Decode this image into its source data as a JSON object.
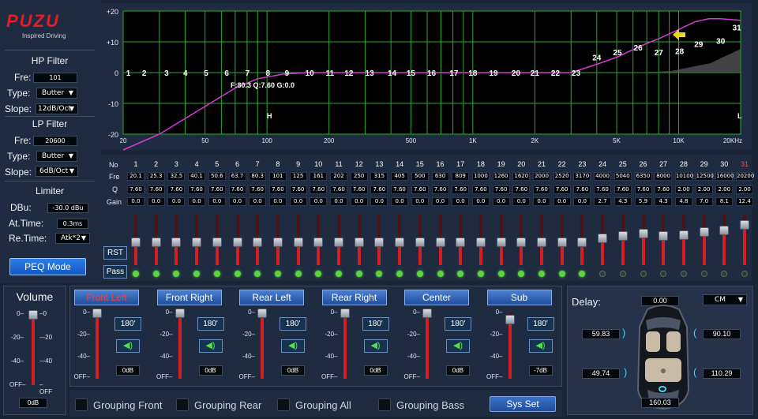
{
  "brand": {
    "name": "PUZU",
    "tagline": "Inspired Driving"
  },
  "hp": {
    "title": "HP Filter",
    "fre_label": "Fre:",
    "fre": "101",
    "type_label": "Type:",
    "type": "Butter",
    "slope_label": "Slope:",
    "slope": "12dB/Oct"
  },
  "lp": {
    "title": "LP Filter",
    "fre_label": "Fre:",
    "fre": "20600",
    "type_label": "Type:",
    "type": "Butter",
    "slope_label": "Slope:",
    "slope": "6dB/Oct"
  },
  "limiter": {
    "title": "Limiter",
    "dbu_label": "DBu:",
    "dbu": "-30.0 dBu",
    "at_label": "At.Time:",
    "at": "0.3ms",
    "re_label": "Re.Time:",
    "re": "Atk*2"
  },
  "peq_button": "PEQ Mode",
  "graph": {
    "ylabels": [
      "+20",
      "+10",
      "0",
      "-10",
      "-20"
    ],
    "xlabels": [
      "20",
      "50",
      "100",
      "200",
      "500",
      "1K",
      "2K",
      "5K",
      "10K",
      "20KHz"
    ],
    "marker_h": "H",
    "marker_l": "L",
    "info": "F:80.3 Q:7.60 G:0.0",
    "band_labels": [
      "1",
      "2",
      "3",
      "4",
      "5",
      "6",
      "7",
      "8",
      "9",
      "10",
      "11",
      "12",
      "13",
      "14",
      "15",
      "16",
      "17",
      "18",
      "19",
      "20",
      "21",
      "22",
      "23",
      "24",
      "25",
      "26",
      "27",
      "28",
      "29",
      "30",
      "31"
    ]
  },
  "eq": {
    "row_no": "No",
    "row_fre": "Fre",
    "row_q": "Q",
    "row_gain": "Gain",
    "bands": [
      "1",
      "2",
      "3",
      "4",
      "5",
      "6",
      "7",
      "8",
      "9",
      "10",
      "11",
      "12",
      "13",
      "14",
      "15",
      "16",
      "17",
      "18",
      "19",
      "20",
      "21",
      "22",
      "23",
      "24",
      "25",
      "26",
      "27",
      "28",
      "29",
      "30",
      "31"
    ],
    "fre": [
      "20.1",
      "25.3",
      "32.5",
      "40.1",
      "50.6",
      "63.7",
      "80.3",
      "101",
      "125",
      "161",
      "202",
      "250",
      "315",
      "405",
      "500",
      "630",
      "809",
      "1000",
      "1260",
      "1620",
      "2000",
      "2520",
      "3170",
      "4000",
      "5040",
      "6350",
      "8000",
      "10100",
      "12500",
      "16000",
      "20200"
    ],
    "q": [
      "7.60",
      "7.60",
      "7.60",
      "7.60",
      "7.60",
      "7.60",
      "7.60",
      "7.60",
      "7.60",
      "7.60",
      "7.60",
      "7.60",
      "7.60",
      "7.60",
      "7.60",
      "7.60",
      "7.60",
      "7.60",
      "7.60",
      "7.60",
      "7.60",
      "7.60",
      "7.60",
      "7.60",
      "7.60",
      "7.60",
      "7.60",
      "2.00",
      "2.00",
      "2.00",
      "2.00"
    ],
    "gain": [
      "0.0",
      "0.0",
      "0.0",
      "0.0",
      "0.0",
      "0.0",
      "0.0",
      "0.0",
      "0.0",
      "0.0",
      "0.0",
      "0.0",
      "0.0",
      "0.0",
      "0.0",
      "0.0",
      "0.0",
      "0.0",
      "0.0",
      "0.0",
      "0.0",
      "0.0",
      "0.0",
      "2.7",
      "4.3",
      "5.9",
      "4.3",
      "4.8",
      "7.0",
      "8.1",
      "12.4"
    ],
    "pass_on": [
      true,
      true,
      true,
      true,
      true,
      true,
      true,
      true,
      true,
      true,
      true,
      true,
      true,
      true,
      true,
      true,
      true,
      true,
      true,
      true,
      true,
      true,
      true,
      false,
      false,
      false,
      false,
      false,
      false,
      false,
      false
    ],
    "rst": "RST",
    "pass": "Pass"
  },
  "volume": {
    "title": "Volume",
    "ticks": [
      "0",
      "-20",
      "-40",
      "OFF"
    ],
    "value": "0dB"
  },
  "channels": [
    {
      "name": "Front Left",
      "phase": "180'",
      "db": "0dB",
      "level": 1.0,
      "active": true
    },
    {
      "name": "Front Right",
      "phase": "180'",
      "db": "0dB",
      "level": 1.0,
      "active": false
    },
    {
      "name": "Rear Left",
      "phase": "180'",
      "db": "0dB",
      "level": 1.0,
      "active": false
    },
    {
      "name": "Rear Right",
      "phase": "180'",
      "db": "0dB",
      "level": 1.0,
      "active": false
    },
    {
      "name": "Center",
      "phase": "180'",
      "db": "0dB",
      "level": 1.0,
      "active": false
    },
    {
      "name": "Sub",
      "phase": "180'",
      "db": "-7dB",
      "level": 0.9,
      "active": false
    }
  ],
  "ch_ticks": [
    "0",
    "-20",
    "-40",
    "OFF"
  ],
  "grouping": [
    "Grouping Front",
    "Grouping Rear",
    "Grouping All",
    "Grouping Bass"
  ],
  "sysset": "Sys Set",
  "delay": {
    "label": "Delay:",
    "top": "0.00",
    "unit": "CM",
    "fl": "59.83",
    "fr": "90.10",
    "rl": "49.74",
    "rr": "110.29",
    "sub": "160.03"
  },
  "colors": {
    "accent": "#5cd63e",
    "curve": "#d63ad6",
    "grid": "#2ea82e",
    "fader": "#d32024"
  }
}
